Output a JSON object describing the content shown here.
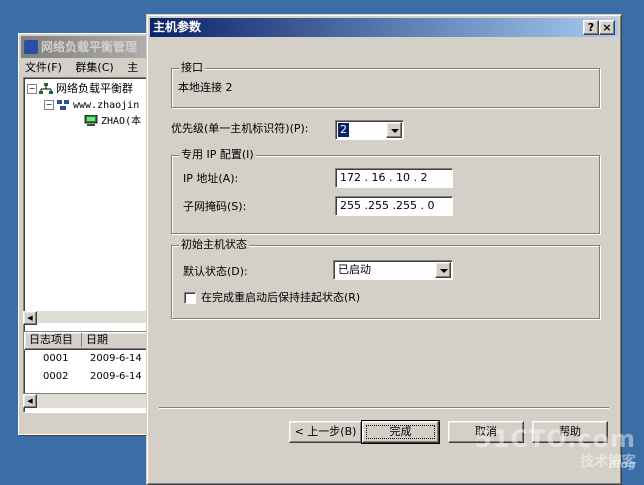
{
  "background_window": {
    "title": "网络负载平衡管理",
    "menu": [
      "文件(F)",
      "群集(C)",
      "主"
    ],
    "tree": {
      "root": "网络负载平衡群",
      "cluster": "www.zhaojin",
      "host": "ZHAO(本"
    },
    "log": {
      "columns": [
        "日志项目",
        "日期"
      ],
      "rows": [
        {
          "id": "0001",
          "date": "2009-6-14"
        },
        {
          "id": "0002",
          "date": "2009-6-14"
        }
      ]
    }
  },
  "dialog": {
    "title": "主机参数",
    "help_label": "?",
    "close_label": "×",
    "interface_group": {
      "label": "接口",
      "value": "本地连接 2"
    },
    "priority": {
      "label": "优先级(单一主机标识符)(P):",
      "value": "2"
    },
    "dedicated_ip_group": {
      "label": "专用 IP 配置(I)",
      "ip_label": "IP 地址(A):",
      "ip_value": "172 . 16 . 10 . 2",
      "mask_label": "子网掩码(S):",
      "mask_value": "255 .255 .255 . 0"
    },
    "initial_state_group": {
      "label": "初始主机状态",
      "default_state_label": "默认状态(D):",
      "default_state_value": "已启动",
      "persist_checkbox_label": "在完成重启动后保持挂起状态(R)",
      "persist_checked": false
    },
    "buttons": {
      "back": "< 上一步(B)",
      "finish": "完成",
      "cancel": "取消",
      "help": "帮助"
    }
  },
  "watermark": {
    "brand": "51CTO.com",
    "tagline": "技术博客",
    "blog": "Blog"
  },
  "colors": {
    "desktop": "#3a6ea5",
    "title_active": "#0a246a",
    "title_active_end": "#a6caf0",
    "face": "#d4d0c8",
    "selection": "#0a246a"
  }
}
